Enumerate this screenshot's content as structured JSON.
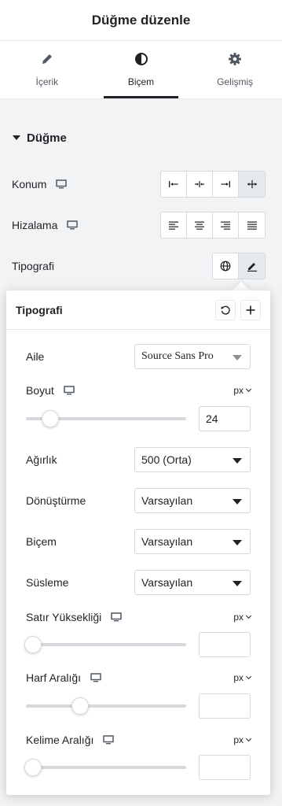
{
  "header": {
    "title": "Düğme düzenle"
  },
  "tabs": [
    {
      "label": "İçerik",
      "icon": "pencil-icon",
      "active": false
    },
    {
      "label": "Biçem",
      "icon": "contrast-icon",
      "active": true
    },
    {
      "label": "Gelişmiş",
      "icon": "gear-icon",
      "active": false
    }
  ],
  "section": {
    "title": "Düğme"
  },
  "controls": {
    "position": {
      "label": "Konum",
      "options": [
        "start",
        "center",
        "end",
        "stretch"
      ],
      "active": "stretch"
    },
    "alignment": {
      "label": "Hizalama",
      "options": [
        "left",
        "center",
        "right",
        "justify"
      ]
    },
    "typography": {
      "label": "Tipografi"
    }
  },
  "popover": {
    "title": "Tipografi",
    "family": {
      "label": "Aile",
      "value": "Source Sans Pro"
    },
    "size": {
      "label": "Boyut",
      "unit": "px",
      "value": "24",
      "slider_fraction": 0.12
    },
    "weight": {
      "label": "Ağırlık",
      "value": "500 (Orta)"
    },
    "transform": {
      "label": "Dönüştürme",
      "value": "Varsayılan"
    },
    "style": {
      "label": "Biçem",
      "value": "Varsayılan"
    },
    "decoration": {
      "label": "Süsleme",
      "value": "Varsayılan"
    },
    "line_height": {
      "label": "Satır Yüksekliği",
      "unit": "px",
      "value": "",
      "slider_fraction": 0.0
    },
    "letter_spacing": {
      "label": "Harf Aralığı",
      "unit": "px",
      "value": "",
      "slider_fraction": 0.33
    },
    "word_spacing": {
      "label": "Kelime Aralığı",
      "unit": "px",
      "value": "",
      "slider_fraction": 0.0
    }
  },
  "colors": {
    "accent": "#1f2124",
    "border": "#d5d8dc",
    "panel_bg": "#f1f3f5"
  }
}
